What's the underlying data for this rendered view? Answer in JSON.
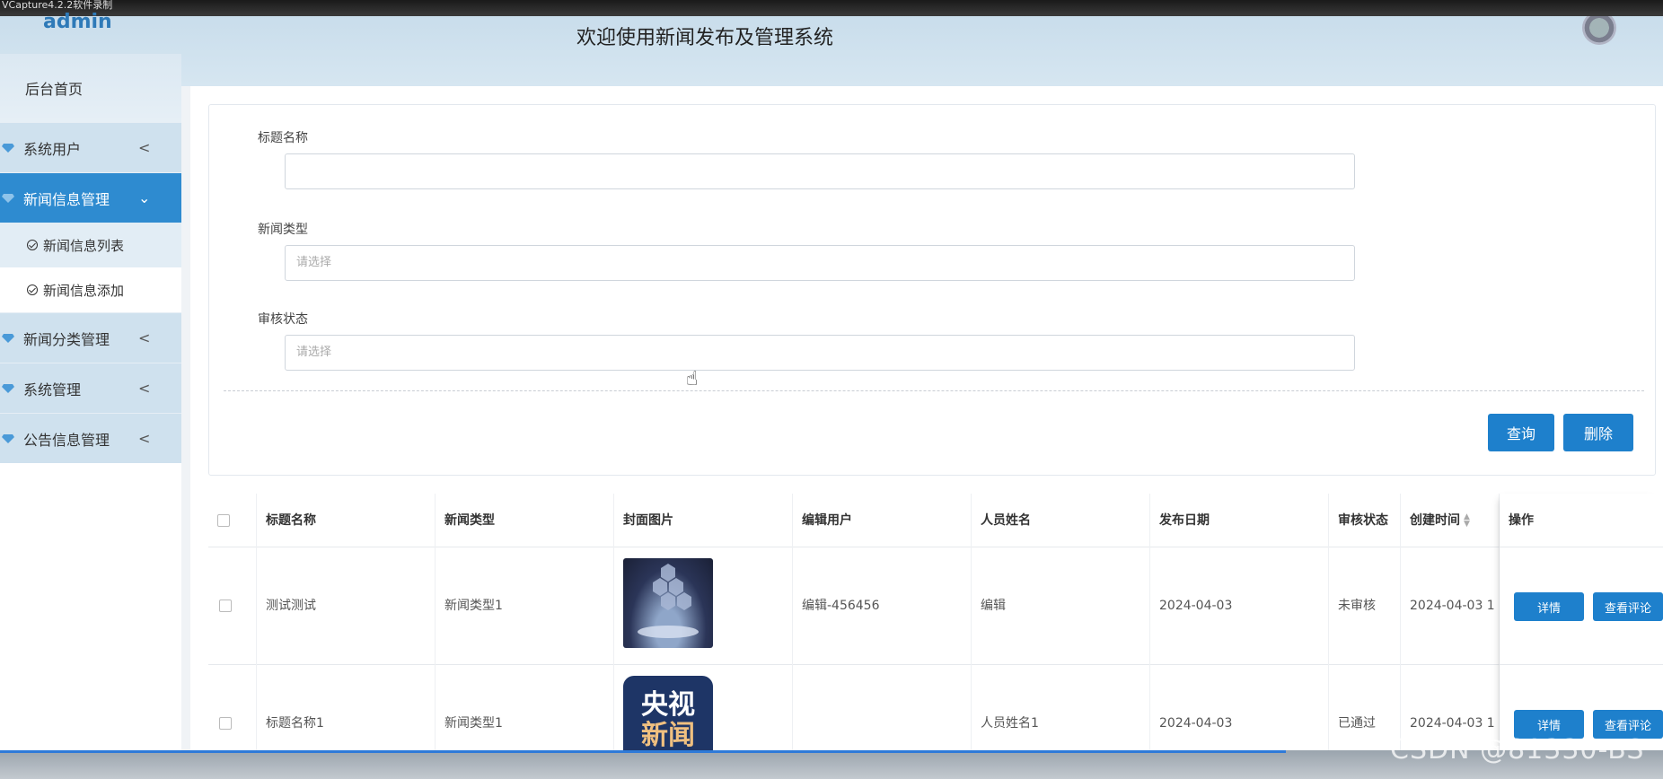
{
  "recorder": {
    "title": "VCapture4.2.2软件录制"
  },
  "header": {
    "brand": "admin",
    "title": "欢迎使用新闻发布及管理系统"
  },
  "sidebar": {
    "home": "后台首页",
    "items": [
      {
        "label": "系统用户",
        "chevron": "<"
      },
      {
        "label": "新闻信息管理",
        "chevron": "⌄"
      },
      {
        "label": "新闻分类管理",
        "chevron": "<"
      },
      {
        "label": "系统管理",
        "chevron": "<"
      },
      {
        "label": "公告信息管理",
        "chevron": "<"
      }
    ],
    "sub_items": [
      {
        "label": "新闻信息列表"
      },
      {
        "label": "新闻信息添加"
      }
    ]
  },
  "search": {
    "title_label": "标题名称",
    "title_value": "",
    "type_label": "新闻类型",
    "type_placeholder": "请选择",
    "status_label": "审核状态",
    "status_placeholder": "请选择",
    "query_button": "查询",
    "delete_button": "删除"
  },
  "table": {
    "columns": [
      "标题名称",
      "新闻类型",
      "封面图片",
      "编辑用户",
      "人员姓名",
      "发布日期",
      "审核状态",
      "创建时间",
      "操作"
    ],
    "rows": [
      {
        "title": "测试测试",
        "type": "新闻类型1",
        "editor": "编辑-456456",
        "person": "编辑",
        "date": "2024-04-03",
        "status": "未审核",
        "created": "2024-04-03 1",
        "detail": "详情",
        "comments": "查看评论"
      },
      {
        "title": "标题名称1",
        "type": "新闻类型1",
        "editor": "",
        "person": "人员姓名1",
        "date": "2024-04-03",
        "status": "已通过",
        "created": "2024-04-03 1",
        "detail": "详情",
        "comments": "查看评论"
      }
    ],
    "thumb2_text": [
      "央视",
      "新闻"
    ]
  },
  "watermark": "CSDN @81330-BS",
  "colors": {
    "primary": "#1e80cc",
    "sidebar_active": "#2e8bd0",
    "sidebar_bg": "#cfe1ee"
  }
}
